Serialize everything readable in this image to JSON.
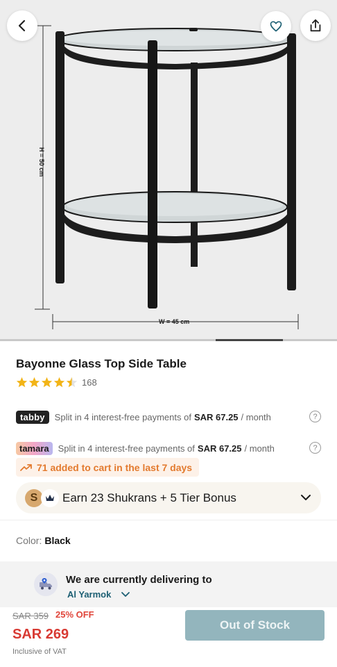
{
  "hero": {
    "height_label": "H = 50 cm",
    "width_label": "W = 45 cm",
    "gallery_position": 0.8
  },
  "product": {
    "title": "Bayonne Glass Top Side Table",
    "rating_value": 4.5,
    "review_count": "168"
  },
  "payments": {
    "tabby": {
      "logo": "tabby",
      "text": "Split in 4 interest-free payments of",
      "amount": "SAR 67.25",
      "suffix": "/ month",
      "help": "?"
    },
    "tamara": {
      "logo": "tamara",
      "text": "Split in 4 interest-free payments of",
      "amount": "SAR 67.25",
      "suffix": "/ month",
      "help": "?"
    }
  },
  "cart_note": "71 added to cart in the last 7 days",
  "shukran": {
    "coin_letter": "S",
    "text": "Earn 23 Shukrans + 5 Tier Bonus"
  },
  "color": {
    "label": "Color:",
    "value": "Black"
  },
  "delivery": {
    "title": "We are currently delivering to",
    "location": "Al Yarmok"
  },
  "footer": {
    "old_price": "SAR 359",
    "discount": "25% OFF",
    "price": "SAR 269",
    "vat_note": "Inclusive of VAT",
    "button_label": "Out of Stock"
  },
  "colors": {
    "accent_red": "#d83a33",
    "cart_note_orange": "#e37a2e",
    "button_disabled": "#93b5bd",
    "location_teal": "#1c5f73"
  }
}
